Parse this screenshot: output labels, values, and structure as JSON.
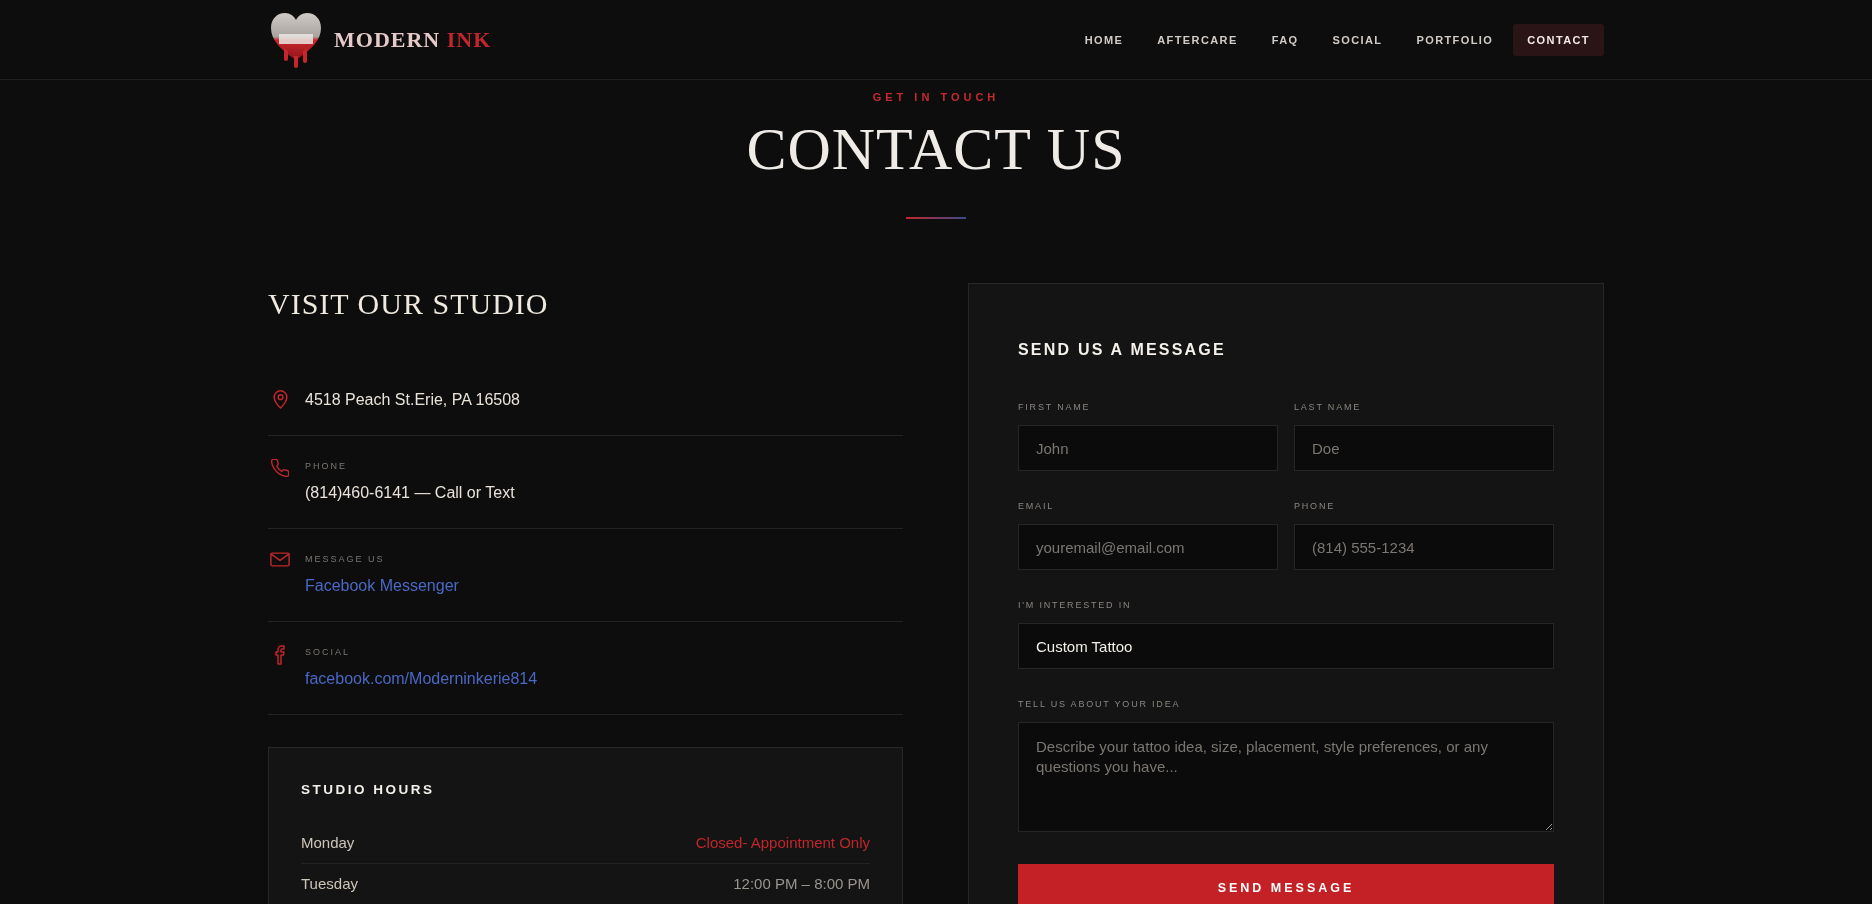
{
  "header": {
    "brand": {
      "name": "MODERN",
      "accent": "INK"
    },
    "nav": [
      {
        "label": "HOME",
        "selected": false
      },
      {
        "label": "AFTERCARE",
        "selected": false
      },
      {
        "label": "FAQ",
        "selected": false
      },
      {
        "label": "SOCIAL",
        "selected": false
      },
      {
        "label": "PORTFOLIO",
        "selected": false
      },
      {
        "label": "CONTACT",
        "selected": true
      }
    ]
  },
  "hero": {
    "eyebrow": "GET IN TOUCH",
    "title": "CONTACT US"
  },
  "studio": {
    "title": "VISIT OUR STUDIO",
    "contacts": [
      {
        "kind": "location",
        "value": "4518 Peach St.Erie, PA 16508",
        "link": false
      },
      {
        "kind": "phone",
        "label": "PHONE",
        "value": "(814)460-6141 — Call or Text",
        "link": false
      },
      {
        "kind": "mail",
        "label": "MESSAGE US",
        "value": "Facebook Messenger",
        "link": true
      },
      {
        "kind": "social",
        "label": "SOCIAL",
        "value": "facebook.com/Moderninkerie814",
        "link": true
      }
    ]
  },
  "hours": {
    "title": "STUDIO HOURS",
    "rows": [
      {
        "day": "Monday",
        "time": "Closed- Appointment Only",
        "closed": true
      },
      {
        "day": "Tuesday",
        "time": "12:00 PM – 8:00 PM",
        "closed": false
      }
    ]
  },
  "form": {
    "title": "SEND US A MESSAGE",
    "rows": [
      [
        {
          "kind": "input",
          "label": "FIRST NAME",
          "placeholder": "John"
        },
        {
          "kind": "input",
          "label": "LAST NAME",
          "placeholder": "Doe"
        }
      ],
      [
        {
          "kind": "input",
          "label": "EMAIL",
          "placeholder": "youremail@email.com"
        },
        {
          "kind": "input",
          "label": "PHONE",
          "placeholder": "(814) 555-1234"
        }
      ],
      [
        {
          "kind": "select",
          "label": "I'M INTERESTED IN",
          "value": "Custom Tattoo"
        }
      ],
      [
        {
          "kind": "textarea",
          "label": "TELL US ABOUT YOUR IDEA",
          "placeholder": "Describe your tattoo idea, size, placement, style preferences, or any questions you have..."
        }
      ]
    ],
    "button": "SEND MESSAGE"
  }
}
